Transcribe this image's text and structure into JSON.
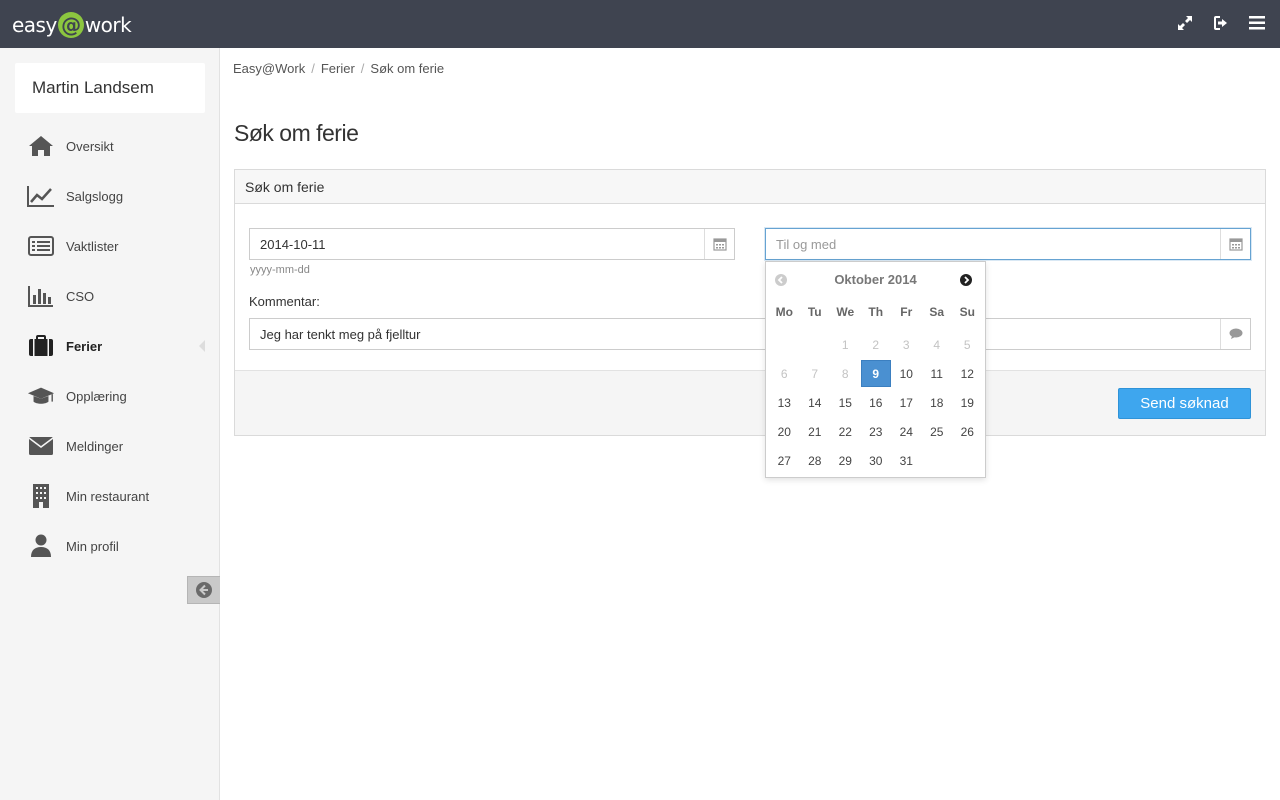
{
  "app": {
    "logo_left": "easy",
    "logo_at": "@",
    "logo_right": "work"
  },
  "topbar": {
    "icons": [
      "expand-icon",
      "sign-out-icon",
      "menu-icon"
    ]
  },
  "user": {
    "name": "Martin Landsem"
  },
  "sidebar": {
    "items": [
      {
        "label": "Oversikt",
        "icon": "home-icon"
      },
      {
        "label": "Salgslogg",
        "icon": "line-chart-icon"
      },
      {
        "label": "Vaktlister",
        "icon": "list-icon"
      },
      {
        "label": "CSO",
        "icon": "bar-chart-icon"
      },
      {
        "label": "Ferier",
        "icon": "briefcase-icon",
        "active": true
      },
      {
        "label": "Opplæring",
        "icon": "graduation-cap-icon"
      },
      {
        "label": "Meldinger",
        "icon": "envelope-icon"
      },
      {
        "label": "Min restaurant",
        "icon": "building-icon"
      },
      {
        "label": "Min profil",
        "icon": "user-icon"
      }
    ]
  },
  "breadcrumb": [
    "Easy@Work",
    "Ferier",
    "Søk om ferie"
  ],
  "page": {
    "title": "Søk om ferie"
  },
  "form": {
    "panel_title": "Søk om ferie",
    "from_value": "2014-10-11",
    "from_help": "yyyy-mm-dd",
    "to_value": "",
    "to_placeholder": "Til og med",
    "comment_label": "Kommentar:",
    "comment_value": "Jeg har tenkt meg på fjelltur",
    "submit_label": "Send søknad"
  },
  "datepicker": {
    "title": "Oktober 2014",
    "weekdays": [
      "Mo",
      "Tu",
      "We",
      "Th",
      "Fr",
      "Sa",
      "Su"
    ],
    "weeks": [
      [
        "",
        "",
        "1",
        "2",
        "3",
        "4",
        "5"
      ],
      [
        "6",
        "7",
        "8",
        "9",
        "10",
        "11",
        "12"
      ],
      [
        "13",
        "14",
        "15",
        "16",
        "17",
        "18",
        "19"
      ],
      [
        "20",
        "21",
        "22",
        "23",
        "24",
        "25",
        "26"
      ],
      [
        "27",
        "28",
        "29",
        "30",
        "31",
        "",
        ""
      ]
    ],
    "disabled_days": [
      "1",
      "2",
      "3",
      "4",
      "5",
      "6",
      "7",
      "8"
    ],
    "highlighted_day": "9"
  },
  "colors": {
    "topbar": "#3f4450",
    "logo_accent": "#8cc63f",
    "primary": "#3ea6ee",
    "today": "#4a90d1"
  }
}
